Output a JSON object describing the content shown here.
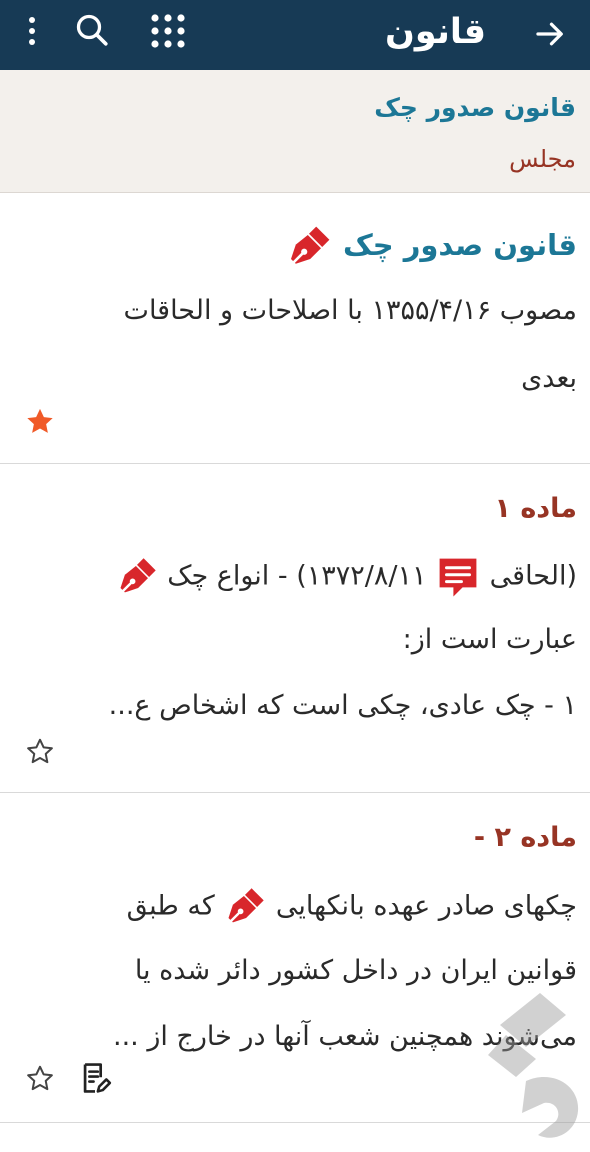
{
  "appbar": {
    "title": "قانون",
    "icons": [
      "arrow-right-icon",
      "apps-grid-icon",
      "search-icon",
      "more-vertical-icon"
    ],
    "color": "#173a55"
  },
  "subheader": {
    "title": "قانون صدور چک",
    "source": "مجلس"
  },
  "law": {
    "title": "قانون صدور چک",
    "line1": "مصوب ۱۳۵۵/۴/۱۶ با اصلاحات و الحاقات",
    "line2": "بعدی",
    "starred": true
  },
  "articles": [
    {
      "title": "ماده ۱",
      "line1_a": "(الحاقی",
      "line1_b": "۱۳۷۲/۸/۱۱) - انواع چک",
      "line2": "عبارت است از:",
      "line3": "۱ - چک عادی، چکی است که اشخاص ع...",
      "starred": false
    },
    {
      "title": "ماده ۲ -",
      "line1_a": "چکهای صادر عهده بانکهایی",
      "line1_b": "که طبق",
      "line2": "قوانین ایران در داخل کشور دائر شده یا",
      "line3": "می‌شوند همچنین شعب آنها در خارج از ...",
      "starred": false
    }
  ],
  "colors": {
    "title_blue": "#1c7796",
    "article_red": "#973424",
    "star_orange": "#f05a28",
    "pen_red": "#d8262b"
  }
}
